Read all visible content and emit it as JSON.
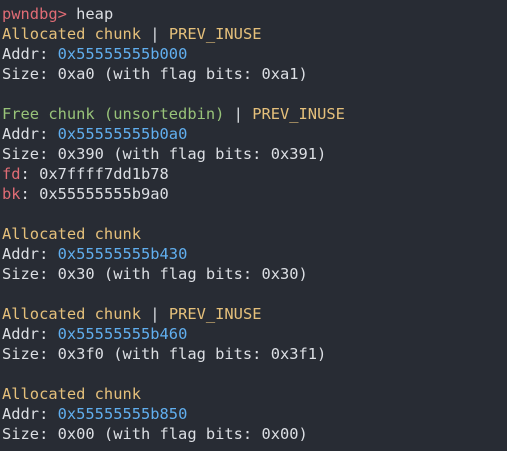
{
  "prompt": {
    "text": "pwndbg> ",
    "command": "heap"
  },
  "chunks": [
    {
      "status": "Allocated chunk",
      "separator": " | ",
      "flag": "PREV_INUSE",
      "addr_label": "Addr: ",
      "addr": "0x55555555b000",
      "size_text": "Size: 0xa0 (with flag bits: 0xa1)"
    },
    {
      "status": "Free chunk (unsortedbin)",
      "separator": " | ",
      "flag": "PREV_INUSE",
      "addr_label": "Addr: ",
      "addr": "0x55555555b0a0",
      "size_text": "Size: 0x390 (with flag bits: 0x391)",
      "fd_label": "fd",
      "fd_value": ": 0x7ffff7dd1b78",
      "bk_label": "bk",
      "bk_value": ": 0x55555555b9a0"
    },
    {
      "status": "Allocated chunk",
      "addr_label": "Addr: ",
      "addr": "0x55555555b430",
      "size_text": "Size: 0x30 (with flag bits: 0x30)"
    },
    {
      "status": "Allocated chunk",
      "separator": " | ",
      "flag": "PREV_INUSE",
      "addr_label": "Addr: ",
      "addr": "0x55555555b460",
      "size_text": "Size: 0x3f0 (with flag bits: 0x3f1)"
    },
    {
      "status": "Allocated chunk",
      "addr_label": "Addr: ",
      "addr": "0x55555555b850",
      "size_text": "Size: 0x00 (with flag bits: 0x00)"
    }
  ],
  "colors": {
    "background": "#282c34",
    "prompt": "#e06c75",
    "allocated": "#e5c07b",
    "free": "#98c379",
    "address": "#61afef",
    "pointer_label": "#e06c75",
    "text": "#dcdfe4"
  }
}
